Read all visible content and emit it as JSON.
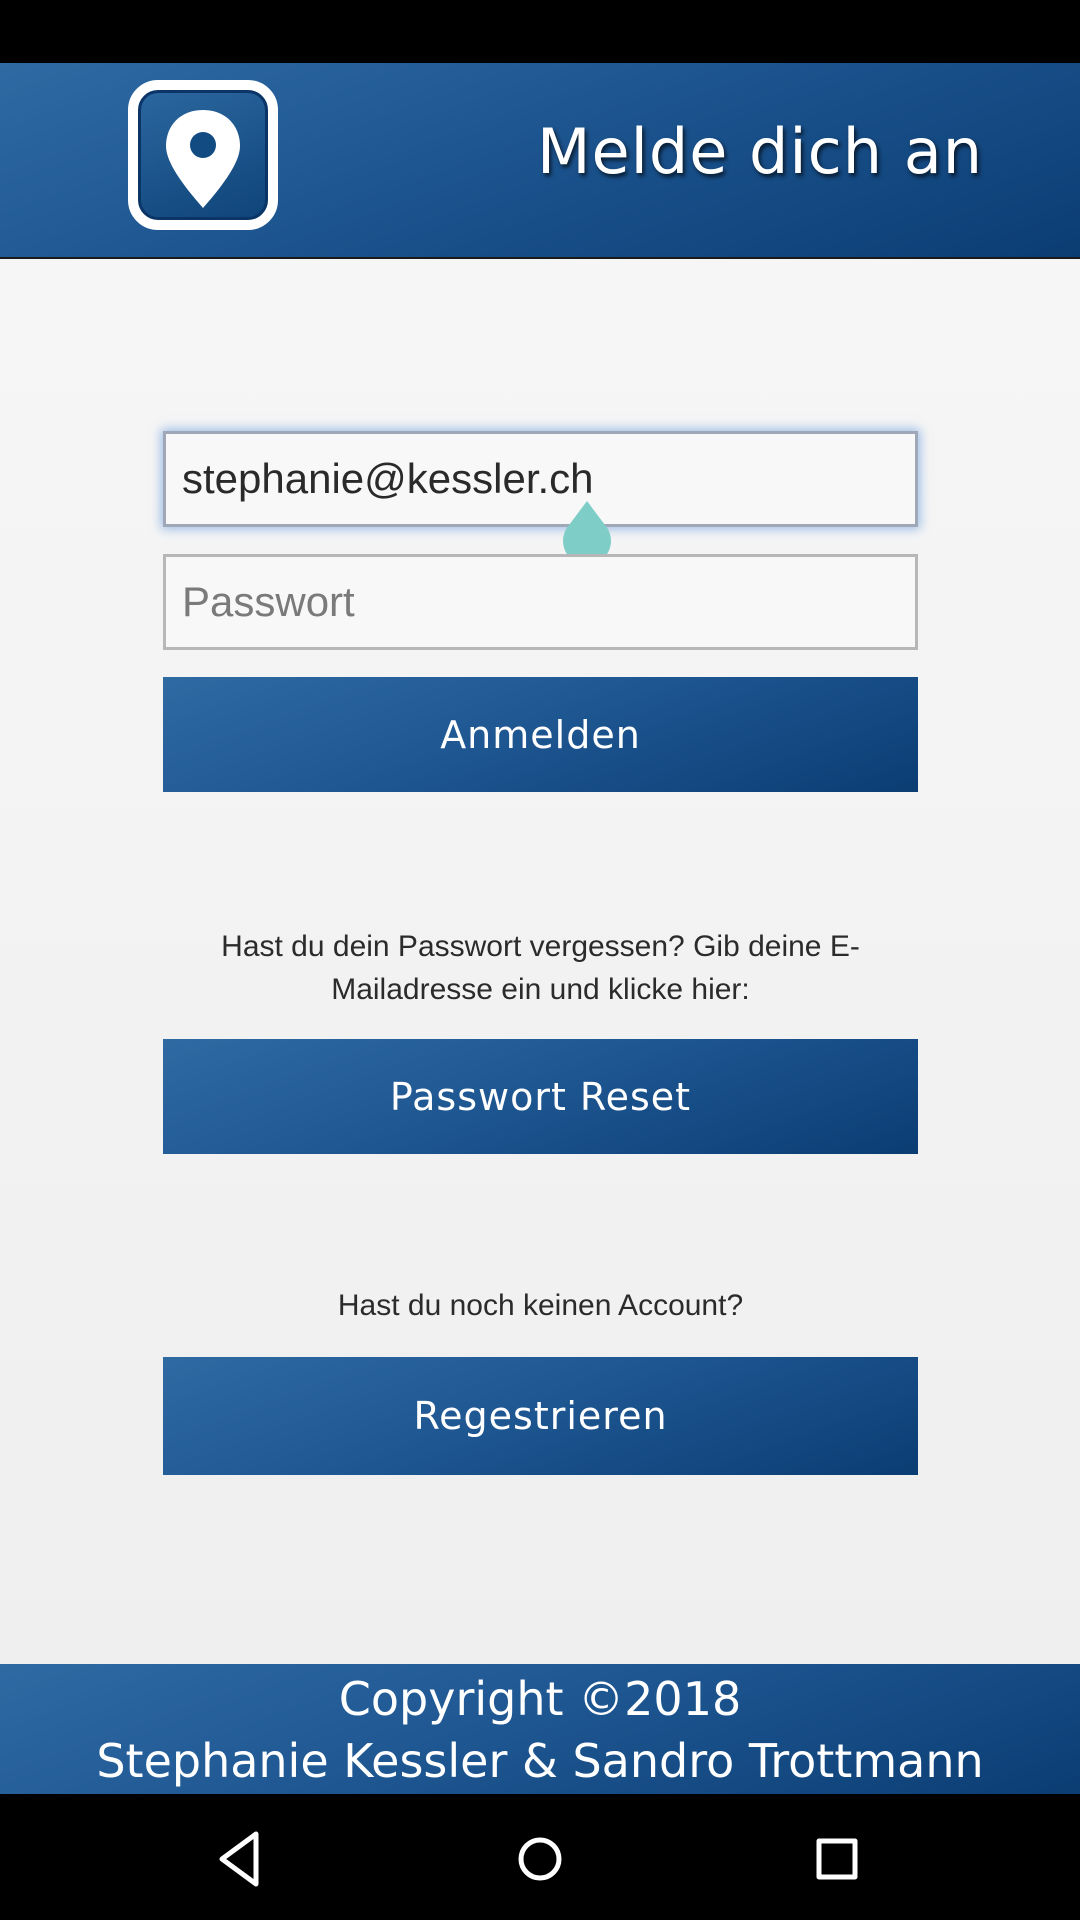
{
  "header": {
    "title": "Melde dich an",
    "logo_icon": "map-pin-icon"
  },
  "login_form": {
    "email_value": "stephanie@kessler.ch",
    "password_placeholder": "Passwort",
    "password_value": "",
    "login_button": "Anmelden"
  },
  "password_reset": {
    "info_text": "Hast du dein Passwort vergessen? Gib deine E-Mailadresse ein und klicke hier:",
    "button": "Passwort Reset"
  },
  "registration": {
    "info_text": "Hast du noch keinen Account?",
    "button": "Regestrieren"
  },
  "footer": {
    "line1": "Copyright ©2018",
    "line2": "Stephanie Kessler & Sandro Trottmann"
  },
  "navigation": {
    "back_icon": "back-triangle-icon",
    "home_icon": "home-circle-icon",
    "recents_icon": "recents-square-icon"
  },
  "colors": {
    "header_blue": "#1d5590",
    "dark_blue": "#0b3d73",
    "light_blue": "#2f6aa3",
    "cursor_handle": "#7fcdc7",
    "background": "#f2f2f2"
  }
}
